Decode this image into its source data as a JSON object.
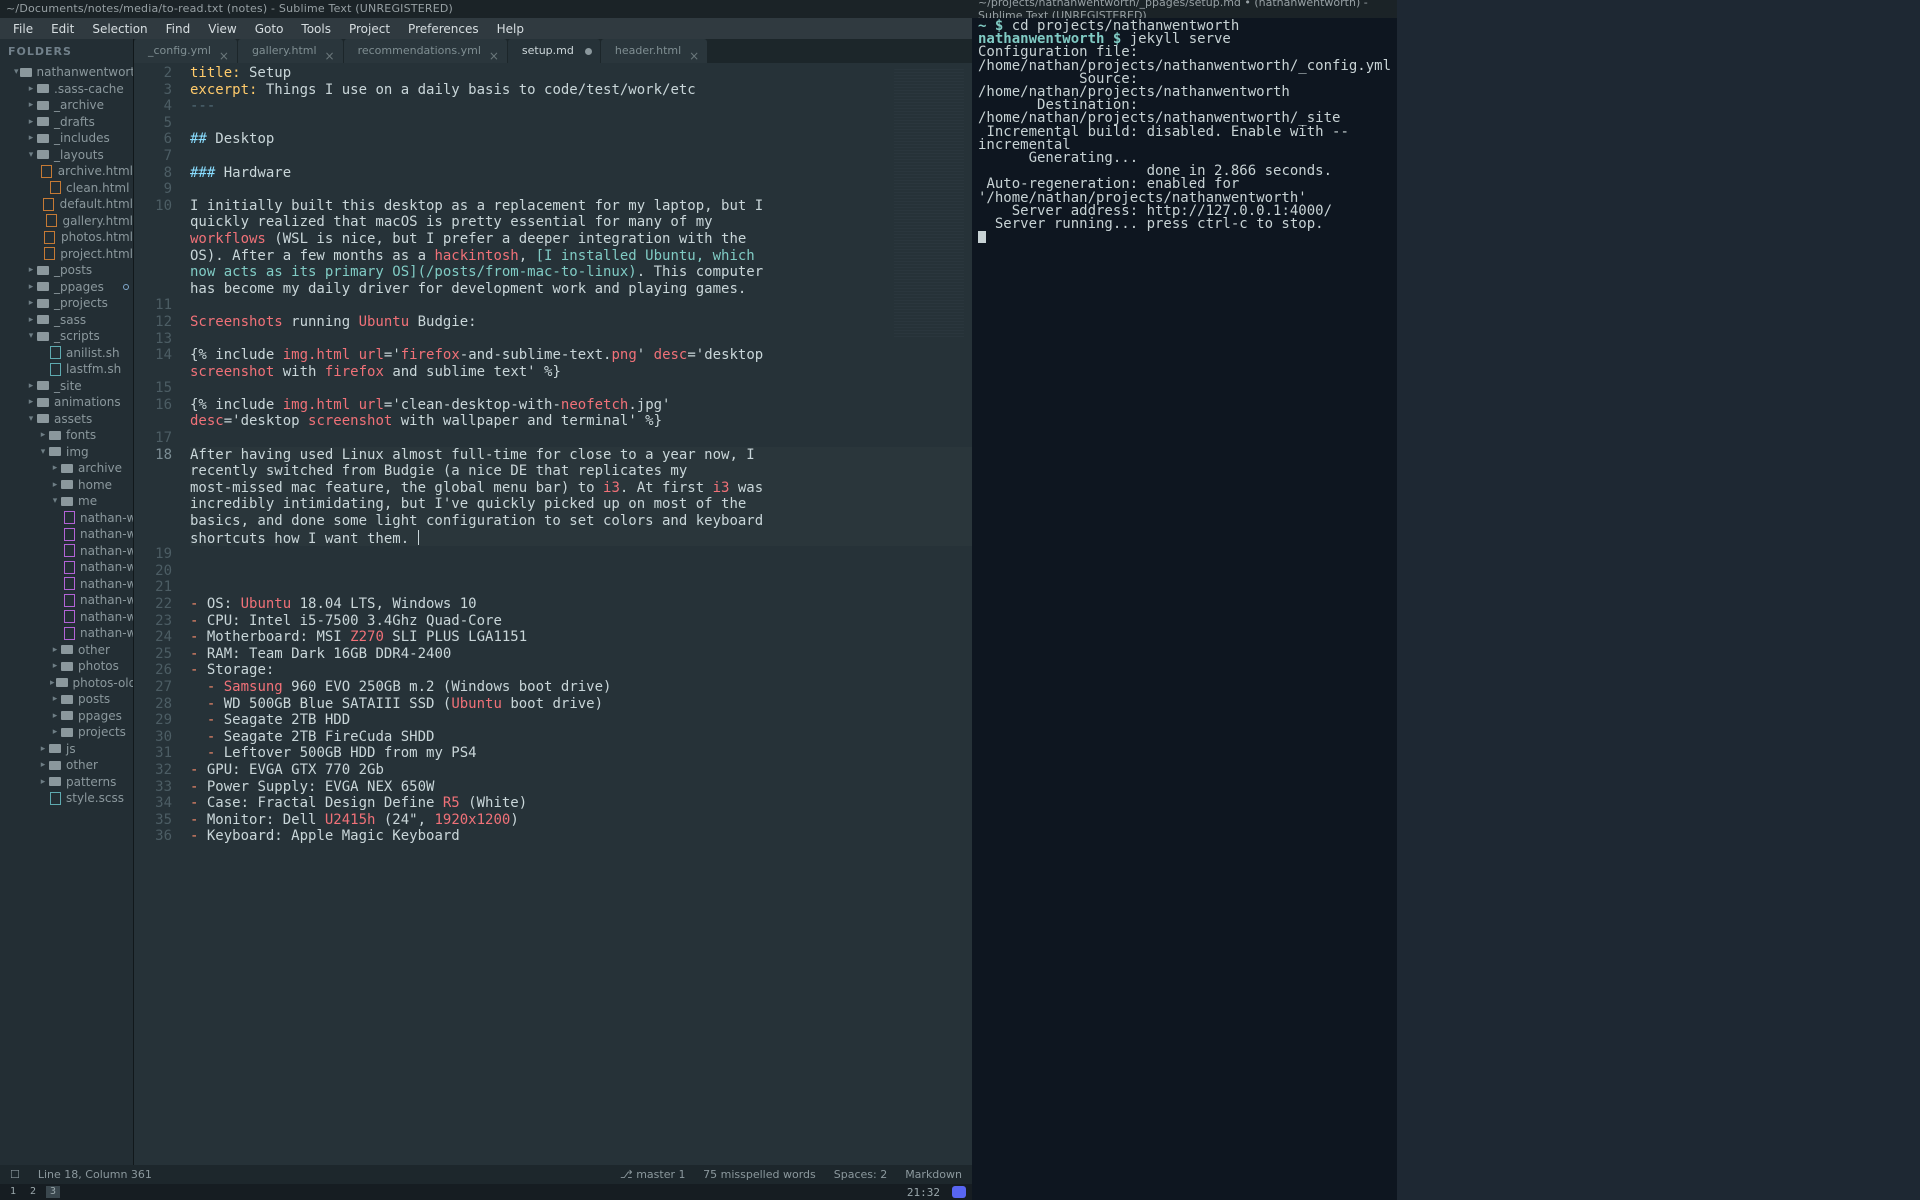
{
  "sublime": {
    "title": "~/Documents/notes/media/to-read.txt (notes) - Sublime Text (UNREGISTERED)",
    "menubar": [
      "File",
      "Edit",
      "Selection",
      "Find",
      "View",
      "Goto",
      "Tools",
      "Project",
      "Preferences",
      "Help"
    ],
    "sidebar": {
      "header": "FOLDERS",
      "tree": [
        {
          "d": 1,
          "a": "down",
          "t": "folder",
          "label": "nathanwentwort",
          "dot": true
        },
        {
          "d": 2,
          "a": "right",
          "t": "folder",
          "label": ".sass-cache"
        },
        {
          "d": 2,
          "a": "right",
          "t": "folder",
          "label": "_archive"
        },
        {
          "d": 2,
          "a": "right",
          "t": "folder",
          "label": "_drafts"
        },
        {
          "d": 2,
          "a": "right",
          "t": "folder",
          "label": "_includes"
        },
        {
          "d": 2,
          "a": "down",
          "t": "folder",
          "label": "_layouts"
        },
        {
          "d": 3,
          "a": "none",
          "t": "file",
          "label": "archive.html"
        },
        {
          "d": 3,
          "a": "none",
          "t": "file",
          "label": "clean.html"
        },
        {
          "d": 3,
          "a": "none",
          "t": "file",
          "label": "default.html"
        },
        {
          "d": 3,
          "a": "none",
          "t": "file",
          "label": "gallery.html"
        },
        {
          "d": 3,
          "a": "none",
          "t": "file",
          "label": "photos.html"
        },
        {
          "d": 3,
          "a": "none",
          "t": "file",
          "label": "project.html"
        },
        {
          "d": 2,
          "a": "right",
          "t": "folder",
          "label": "_posts"
        },
        {
          "d": 2,
          "a": "right",
          "t": "folder",
          "label": "_ppages",
          "dot": true
        },
        {
          "d": 2,
          "a": "right",
          "t": "folder",
          "label": "_projects"
        },
        {
          "d": 2,
          "a": "right",
          "t": "folder",
          "label": "_sass"
        },
        {
          "d": 2,
          "a": "down",
          "t": "folder",
          "label": "_scripts"
        },
        {
          "d": 3,
          "a": "none",
          "t": "filey",
          "label": "anilist.sh"
        },
        {
          "d": 3,
          "a": "none",
          "t": "filey",
          "label": "lastfm.sh"
        },
        {
          "d": 2,
          "a": "right",
          "t": "folder",
          "label": "_site"
        },
        {
          "d": 2,
          "a": "right",
          "t": "folder",
          "label": "animations"
        },
        {
          "d": 2,
          "a": "down",
          "t": "folder",
          "label": "assets"
        },
        {
          "d": 3,
          "a": "right",
          "t": "folder",
          "label": "fonts"
        },
        {
          "d": 3,
          "a": "down",
          "t": "folder",
          "label": "img"
        },
        {
          "d": 4,
          "a": "right",
          "t": "folder",
          "label": "archive"
        },
        {
          "d": 4,
          "a": "right",
          "t": "folder",
          "label": "home"
        },
        {
          "d": 4,
          "a": "down",
          "t": "folder",
          "label": "me"
        },
        {
          "d": 5,
          "a": "none",
          "t": "purple",
          "label": "nathan-wen"
        },
        {
          "d": 5,
          "a": "none",
          "t": "purple",
          "label": "nathan-wen"
        },
        {
          "d": 5,
          "a": "none",
          "t": "purple",
          "label": "nathan-wen"
        },
        {
          "d": 5,
          "a": "none",
          "t": "purple",
          "label": "nathan-wen"
        },
        {
          "d": 5,
          "a": "none",
          "t": "purple",
          "label": "nathan-wen"
        },
        {
          "d": 5,
          "a": "none",
          "t": "purple",
          "label": "nathan-wen"
        },
        {
          "d": 5,
          "a": "none",
          "t": "purple",
          "label": "nathan-wen"
        },
        {
          "d": 5,
          "a": "none",
          "t": "purple",
          "label": "nathan-wen"
        },
        {
          "d": 4,
          "a": "right",
          "t": "folder",
          "label": "other"
        },
        {
          "d": 4,
          "a": "right",
          "t": "folder",
          "label": "photos"
        },
        {
          "d": 4,
          "a": "right",
          "t": "folder",
          "label": "photos-old"
        },
        {
          "d": 4,
          "a": "right",
          "t": "folder",
          "label": "posts"
        },
        {
          "d": 4,
          "a": "right",
          "t": "folder",
          "label": "ppages"
        },
        {
          "d": 4,
          "a": "right",
          "t": "folder",
          "label": "projects"
        },
        {
          "d": 3,
          "a": "right",
          "t": "folder",
          "label": "js"
        },
        {
          "d": 3,
          "a": "right",
          "t": "folder",
          "label": "other"
        },
        {
          "d": 3,
          "a": "right",
          "t": "folder",
          "label": "patterns"
        },
        {
          "d": 3,
          "a": "none",
          "t": "filey",
          "label": "style.scss"
        }
      ]
    },
    "tabs": [
      {
        "label": "_config.yml",
        "active": false,
        "mod": false
      },
      {
        "label": "gallery.html",
        "active": false,
        "mod": false
      },
      {
        "label": "recommendations.yml",
        "active": false,
        "mod": false
      },
      {
        "label": "setup.md",
        "active": true,
        "mod": true
      },
      {
        "label": "header.html",
        "active": false,
        "mod": false
      }
    ],
    "gutter_start": 2,
    "gutter_end": 36,
    "current_line": 18,
    "code_lines": [
      [
        {
          "c": "c-y",
          "s": "title:"
        },
        {
          "c": "",
          "s": " Setup"
        }
      ],
      [
        {
          "c": "c-y",
          "s": "excerpt:"
        },
        {
          "c": "",
          "s": " Things I use on a daily basis to code/test/work/etc"
        }
      ],
      [
        {
          "c": "c-d",
          "s": "---"
        }
      ],
      [],
      [
        {
          "c": "c-c",
          "s": "## "
        },
        {
          "c": "",
          "s": "Desktop"
        }
      ],
      [],
      [
        {
          "c": "c-c",
          "s": "### "
        },
        {
          "c": "",
          "s": "Hardware"
        }
      ],
      [],
      [
        {
          "c": "",
          "s": "I initially built this desktop as a replacement for my laptop, but I "
        }
      ],
      [
        {
          "c": "",
          "s": "quickly realized that macOS is pretty essential for many of my "
        }
      ],
      [
        {
          "c": "c-r",
          "s": "workflows"
        },
        {
          "c": "",
          "s": " (WSL is nice, but I prefer a deeper integration with the "
        }
      ],
      [
        {
          "c": "",
          "s": "OS). After a few months as a "
        },
        {
          "c": "c-r",
          "s": "hackintosh"
        },
        {
          "c": "",
          "s": ", "
        },
        {
          "c": "c-t",
          "s": "[I installed Ubuntu, which "
        }
      ],
      [
        {
          "c": "c-t",
          "s": "now acts as its primary OS](/posts/from-mac-to-linux)"
        },
        {
          "c": "",
          "s": ". This computer "
        }
      ],
      [
        {
          "c": "",
          "s": "has become my daily driver for development work and playing games."
        }
      ],
      [],
      [
        {
          "c": "c-r",
          "s": "Screenshots"
        },
        {
          "c": "",
          "s": " running "
        },
        {
          "c": "c-r",
          "s": "Ubuntu"
        },
        {
          "c": "",
          "s": " Budgie:"
        }
      ],
      [],
      [
        {
          "c": "",
          "s": "{% include "
        },
        {
          "c": "c-r",
          "s": "img.html"
        },
        {
          "c": "",
          "s": " "
        },
        {
          "c": "c-r",
          "s": "url"
        },
        {
          "c": "",
          "s": "='"
        },
        {
          "c": "c-r",
          "s": "firefox"
        },
        {
          "c": "",
          "s": "-and-sublime-text."
        },
        {
          "c": "c-r",
          "s": "png"
        },
        {
          "c": "",
          "s": "' "
        },
        {
          "c": "c-r",
          "s": "desc"
        },
        {
          "c": "",
          "s": "='desktop "
        }
      ],
      [
        {
          "c": "c-r",
          "s": "screenshot"
        },
        {
          "c": "",
          "s": " with "
        },
        {
          "c": "c-r",
          "s": "firefox"
        },
        {
          "c": "",
          "s": " and sublime text' %}"
        }
      ],
      [],
      [
        {
          "c": "",
          "s": "{% include "
        },
        {
          "c": "c-r",
          "s": "img.html"
        },
        {
          "c": "",
          "s": " "
        },
        {
          "c": "c-r",
          "s": "url"
        },
        {
          "c": "",
          "s": "='clean-desktop-with-"
        },
        {
          "c": "c-r",
          "s": "neofetch"
        },
        {
          "c": "",
          "s": ".jpg' "
        }
      ],
      [
        {
          "c": "c-r",
          "s": "desc"
        },
        {
          "c": "",
          "s": "='desktop "
        },
        {
          "c": "c-r",
          "s": "screenshot"
        },
        {
          "c": "",
          "s": " with wallpaper and terminal' %}"
        }
      ],
      [],
      [
        {
          "c": "",
          "s": "After having used Linux almost full-time for close to a year now, I "
        }
      ],
      [
        {
          "c": "",
          "s": "recently switched from Budgie (a nice DE that replicates my "
        }
      ],
      [
        {
          "c": "",
          "s": "most-missed mac feature, the global menu bar) to "
        },
        {
          "c": "c-r",
          "s": "i3"
        },
        {
          "c": "",
          "s": ". At first "
        },
        {
          "c": "c-r",
          "s": "i3"
        },
        {
          "c": "",
          "s": " was "
        }
      ],
      [
        {
          "c": "",
          "s": "incredibly intimidating, but I've quickly picked up on most of the "
        }
      ],
      [
        {
          "c": "",
          "s": "basics, and done some light configuration to set colors and keyboard "
        }
      ],
      [
        {
          "c": "",
          "s": "shortcuts how I want them. "
        },
        {
          "c": "cursor",
          "s": ""
        }
      ],
      [],
      [],
      [],
      [
        {
          "c": "c-o",
          "s": "-"
        },
        {
          "c": "",
          "s": " OS: "
        },
        {
          "c": "c-r",
          "s": "Ubuntu"
        },
        {
          "c": "",
          "s": " 18.04 LTS, Windows 10"
        }
      ],
      [
        {
          "c": "c-o",
          "s": "-"
        },
        {
          "c": "",
          "s": " CPU: Intel i5-7500 3.4Ghz Quad-Core"
        }
      ],
      [
        {
          "c": "c-o",
          "s": "-"
        },
        {
          "c": "",
          "s": " Motherboard: MSI "
        },
        {
          "c": "c-r",
          "s": "Z270"
        },
        {
          "c": "",
          "s": " SLI PLUS LGA1151"
        }
      ],
      [
        {
          "c": "c-o",
          "s": "-"
        },
        {
          "c": "",
          "s": " RAM: Team Dark 16GB DDR4-2400"
        }
      ],
      [
        {
          "c": "c-o",
          "s": "-"
        },
        {
          "c": "",
          "s": " Storage:"
        }
      ],
      [
        {
          "c": "",
          "s": "  "
        },
        {
          "c": "c-o",
          "s": "-"
        },
        {
          "c": "",
          "s": " "
        },
        {
          "c": "c-r",
          "s": "Samsung"
        },
        {
          "c": "",
          "s": " 960 EVO 250GB m.2 (Windows boot drive)"
        }
      ],
      [
        {
          "c": "",
          "s": "  "
        },
        {
          "c": "c-o",
          "s": "-"
        },
        {
          "c": "",
          "s": " WD 500GB Blue SATAIII SSD ("
        },
        {
          "c": "c-r",
          "s": "Ubuntu"
        },
        {
          "c": "",
          "s": " boot drive)"
        }
      ],
      [
        {
          "c": "",
          "s": "  "
        },
        {
          "c": "c-o",
          "s": "-"
        },
        {
          "c": "",
          "s": " Seagate 2TB HDD"
        }
      ],
      [
        {
          "c": "",
          "s": "  "
        },
        {
          "c": "c-o",
          "s": "-"
        },
        {
          "c": "",
          "s": " Seagate 2TB FireCuda SHDD"
        }
      ],
      [
        {
          "c": "",
          "s": "  "
        },
        {
          "c": "c-o",
          "s": "-"
        },
        {
          "c": "",
          "s": " Leftover 500GB HDD from my PS4"
        }
      ],
      [
        {
          "c": "c-o",
          "s": "-"
        },
        {
          "c": "",
          "s": " GPU: EVGA GTX 770 2Gb"
        }
      ],
      [
        {
          "c": "c-o",
          "s": "-"
        },
        {
          "c": "",
          "s": " Power Supply: EVGA NEX 650W"
        }
      ],
      [
        {
          "c": "c-o",
          "s": "-"
        },
        {
          "c": "",
          "s": " Case: Fractal Design Define "
        },
        {
          "c": "c-r",
          "s": "R5"
        },
        {
          "c": "",
          "s": " (White)"
        }
      ],
      [
        {
          "c": "c-o",
          "s": "-"
        },
        {
          "c": "",
          "s": " Monitor: Dell "
        },
        {
          "c": "c-r",
          "s": "U2415h"
        },
        {
          "c": "",
          "s": " (24\", "
        },
        {
          "c": "c-r",
          "s": "1920x1200"
        },
        {
          "c": "",
          "s": ")"
        }
      ],
      [
        {
          "c": "c-o",
          "s": "-"
        },
        {
          "c": "",
          "s": " Keyboard: Apple Magic Keyboard"
        }
      ]
    ],
    "status": {
      "pos": "Line 18, Column 361",
      "branch": "master",
      "branch_badge": "1",
      "spell": "75 misspelled words",
      "spaces": "Spaces: 2",
      "syntax": "Markdown"
    },
    "workspaces": [
      "1",
      "2",
      "3"
    ],
    "workspace_current": 2,
    "clock": "21:32"
  },
  "terminal": {
    "title": "~/projects/nathanwentworth/_ppages/setup.md • (nathanwentworth) - Sublime Text (UNREGISTERED)",
    "lines": [
      [
        {
          "c": "t-p",
          "s": "~ $ "
        },
        {
          "c": "",
          "s": "cd projects/nathanwentworth"
        }
      ],
      [
        {
          "c": "t-p",
          "s": "nathanwentworth $ "
        },
        {
          "c": "",
          "s": "jekyll serve"
        }
      ],
      [
        {
          "c": "",
          "s": "Configuration file: /home/nathan/projects/nathanwentworth/_config.yml"
        }
      ],
      [
        {
          "c": "",
          "s": "            Source: /home/nathan/projects/nathanwentworth"
        }
      ],
      [
        {
          "c": "",
          "s": "       Destination: /home/nathan/projects/nathanwentworth/_site"
        }
      ],
      [
        {
          "c": "",
          "s": " Incremental build: disabled. Enable with --incremental"
        }
      ],
      [
        {
          "c": "",
          "s": "      Generating..."
        }
      ],
      [
        {
          "c": "",
          "s": "                    done in 2.866 seconds."
        }
      ],
      [
        {
          "c": "",
          "s": " Auto-regeneration: enabled for '/home/nathan/projects/nathanwentworth'"
        }
      ],
      [
        {
          "c": "",
          "s": "    Server address: http://127.0.0.1:4000/"
        }
      ],
      [
        {
          "c": "",
          "s": "  Server running... press ctrl-c to stop."
        }
      ],
      [
        {
          "c": "",
          "s": ""
        },
        {
          "c": "cur",
          "s": ""
        }
      ]
    ]
  }
}
